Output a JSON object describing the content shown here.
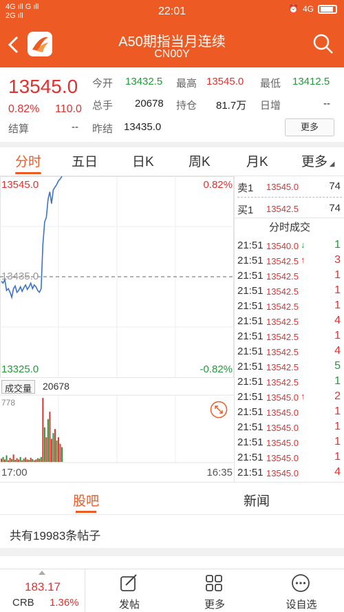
{
  "status_bar": {
    "left_top": "4G ıll G ıll",
    "left_bottom": "2G ıll",
    "sim_icon": "sim-icon",
    "time": "22:01",
    "right": "4G"
  },
  "header": {
    "title": "A50期指当月连续",
    "subtitle": "CN00Y"
  },
  "quote": {
    "price": "13545.0",
    "change_pct": "0.82%",
    "change": "110.0",
    "settle_label": "结算",
    "settle_value": "--",
    "open_label": "今开",
    "open_value": "13432.5",
    "high_label": "最高",
    "high_value": "13545.0",
    "low_label": "最低",
    "low_value": "13412.5",
    "volume_label": "总手",
    "volume_value": "20678",
    "oi_label": "持仓",
    "oi_value": "81.7万",
    "daily_inc_label": "日增",
    "daily_inc_value": "--",
    "prev_settle_label": "昨结",
    "prev_settle_value": "13435.0",
    "more_label": "更多"
  },
  "tabs": [
    "分时",
    "五日",
    "日K",
    "周K",
    "月K",
    "更多"
  ],
  "chart": {
    "top_price": "13545.0",
    "top_pct": "0.82%",
    "bottom_price": "13325.0",
    "bottom_pct": "-0.82%",
    "ref_price": "13435.0",
    "volume_label": "成交量",
    "volume_value": "20678",
    "volume_max": "778",
    "time_start": "17:00",
    "time_end": "16:35"
  },
  "chart_data": {
    "type": "line",
    "ylim": [
      13325.0,
      13545.0
    ],
    "reference": 13435.0,
    "price_series": [
      13430,
      13428,
      13432,
      13420,
      13422,
      13418,
      13412.5,
      13422,
      13425,
      13418,
      13420,
      13424,
      13419,
      13423,
      13426,
      13421,
      13424,
      13428,
      13422,
      13426,
      13424,
      13420,
      13418,
      13422,
      13470,
      13495,
      13500,
      13520,
      13528,
      13515,
      13530,
      13533,
      13536,
      13540,
      13542,
      13545
    ],
    "volume_series": [
      40,
      60,
      30,
      80,
      20,
      50,
      35,
      90,
      25,
      45,
      30,
      60,
      20,
      40,
      55,
      30,
      25,
      50,
      35,
      20,
      30,
      45,
      40,
      60,
      778,
      420,
      300,
      520,
      610,
      280,
      350,
      400,
      260,
      300,
      220,
      180
    ],
    "volume_up": [
      true,
      false,
      true,
      false,
      true,
      true,
      false,
      true,
      false,
      true,
      true,
      false,
      true,
      false,
      true,
      true,
      false,
      true,
      false,
      true,
      true,
      false,
      true,
      false,
      true,
      false,
      true,
      false,
      true,
      true,
      false,
      true,
      false,
      true,
      true,
      false
    ]
  },
  "book": {
    "ask_label": "卖1",
    "ask_price": "13545.0",
    "ask_qty": "74",
    "bid_label": "买1",
    "bid_price": "13542.5",
    "bid_qty": "74",
    "ticks_title": "分时成交"
  },
  "ticks": [
    {
      "time": "21:51",
      "price": "13540.0",
      "arrow": "↓",
      "qty": "1",
      "dir": "down"
    },
    {
      "time": "21:51",
      "price": "13542.5",
      "arrow": "↑",
      "qty": "3",
      "dir": "up"
    },
    {
      "time": "21:51",
      "price": "13542.5",
      "arrow": "",
      "qty": "1",
      "dir": "up"
    },
    {
      "time": "21:51",
      "price": "13542.5",
      "arrow": "",
      "qty": "1",
      "dir": "up"
    },
    {
      "time": "21:51",
      "price": "13542.5",
      "arrow": "",
      "qty": "1",
      "dir": "up"
    },
    {
      "time": "21:51",
      "price": "13542.5",
      "arrow": "",
      "qty": "4",
      "dir": "up"
    },
    {
      "time": "21:51",
      "price": "13542.5",
      "arrow": "",
      "qty": "1",
      "dir": "up"
    },
    {
      "time": "21:51",
      "price": "13542.5",
      "arrow": "",
      "qty": "4",
      "dir": "up"
    },
    {
      "time": "21:51",
      "price": "13542.5",
      "arrow": "",
      "qty": "5",
      "dir": "down"
    },
    {
      "time": "21:51",
      "price": "13542.5",
      "arrow": "",
      "qty": "1",
      "dir": "down"
    },
    {
      "time": "21:51",
      "price": "13545.0",
      "arrow": "↑",
      "qty": "2",
      "dir": "up"
    },
    {
      "time": "21:51",
      "price": "13545.0",
      "arrow": "",
      "qty": "1",
      "dir": "up"
    },
    {
      "time": "21:51",
      "price": "13545.0",
      "arrow": "",
      "qty": "1",
      "dir": "up"
    },
    {
      "time": "21:51",
      "price": "13545.0",
      "arrow": "",
      "qty": "1",
      "dir": "up"
    },
    {
      "time": "21:51",
      "price": "13545.0",
      "arrow": "",
      "qty": "1",
      "dir": "up"
    },
    {
      "time": "21:51",
      "price": "13545.0",
      "arrow": "",
      "qty": "4",
      "dir": "up"
    }
  ],
  "subtabs": [
    "股吧",
    "新闻"
  ],
  "posts_text": "共有19983条帖子",
  "bottom_bar": {
    "crb_value": "183.17",
    "crb_name": "CRB",
    "crb_pct": "1.36%",
    "post_label": "发帖",
    "more_label": "更多",
    "watch_label": "设自选"
  },
  "colors": {
    "accent": "#ee5a24",
    "up": "#e2312f",
    "down": "#1f9b37",
    "line": "#3a73c9"
  }
}
